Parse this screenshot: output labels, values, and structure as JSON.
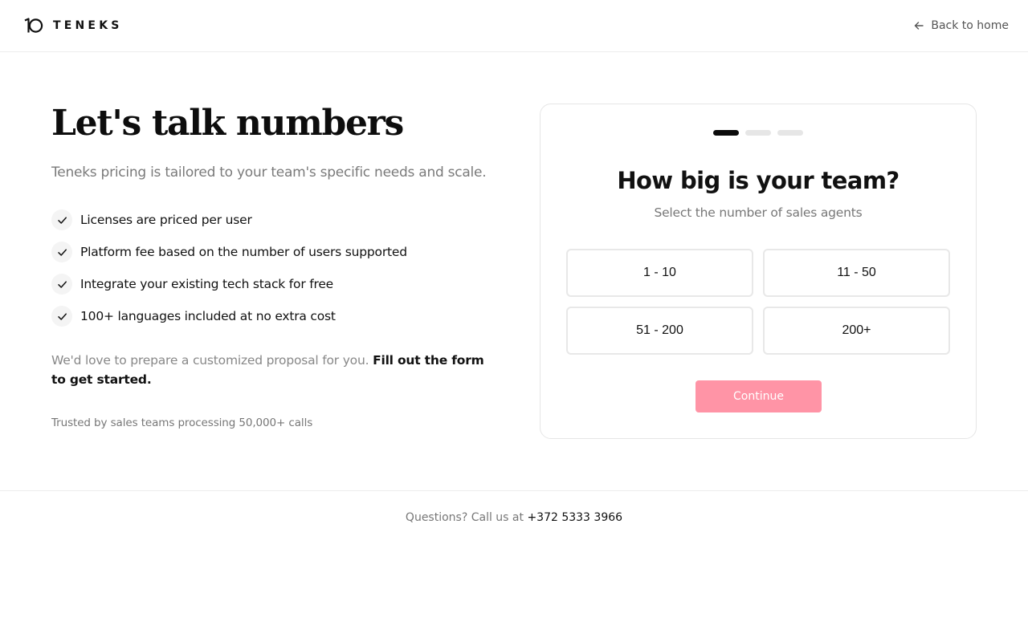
{
  "brand": {
    "name": "TENEKS"
  },
  "header": {
    "back_label": "Back to home"
  },
  "hero": {
    "title": "Let's talk numbers",
    "subtitle": "Teneks pricing is tailored to your team's specific needs and scale.",
    "features": [
      "Licenses are priced per user",
      "Platform fee based on the number of users supported",
      "Integrate your existing tech stack for free",
      "100+ languages included at no extra cost"
    ],
    "proposal_text": "We'd love to prepare a customized proposal for you.",
    "proposal_link": "Fill out the form to get started.",
    "trusted": "Trusted by sales teams processing 50,000+ calls"
  },
  "form": {
    "current_step": 1,
    "total_steps": 3,
    "title": "How big is your team?",
    "subtitle": "Select the number of sales agents",
    "options": [
      "1 - 10",
      "11 - 50",
      "51 - 200",
      "200+"
    ],
    "continue_label": "Continue"
  },
  "footer": {
    "text": "Questions? Call us at",
    "phone": "+372 5333 3966"
  },
  "colors": {
    "accent_disabled": "#ff94a6",
    "step_active": "#0b0b0b",
    "step_inactive": "#e6e6e6"
  }
}
